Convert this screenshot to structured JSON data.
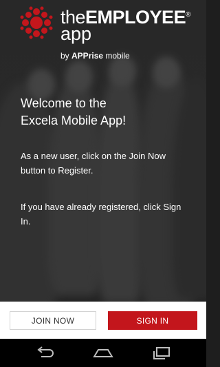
{
  "brand": {
    "the": "the",
    "employee": "EMPLOYEE",
    "reg": "®",
    "app": "app",
    "by": "by ",
    "apprise": "APPrise",
    "mobile": " mobile",
    "logo_color": "#c3161c"
  },
  "welcome": {
    "line1": "Welcome to the",
    "line2": "Excela Mobile App!"
  },
  "body": {
    "p1": "As a new user, click on the Join Now button to Register.",
    "p2": "If you have already registered, click Sign In."
  },
  "buttons": {
    "join": "JOIN NOW",
    "sign_in": "SIGN IN",
    "accent": "#c3161c"
  },
  "navbar": {
    "icons": [
      "back-icon",
      "home-icon",
      "recent-apps-icon"
    ]
  }
}
